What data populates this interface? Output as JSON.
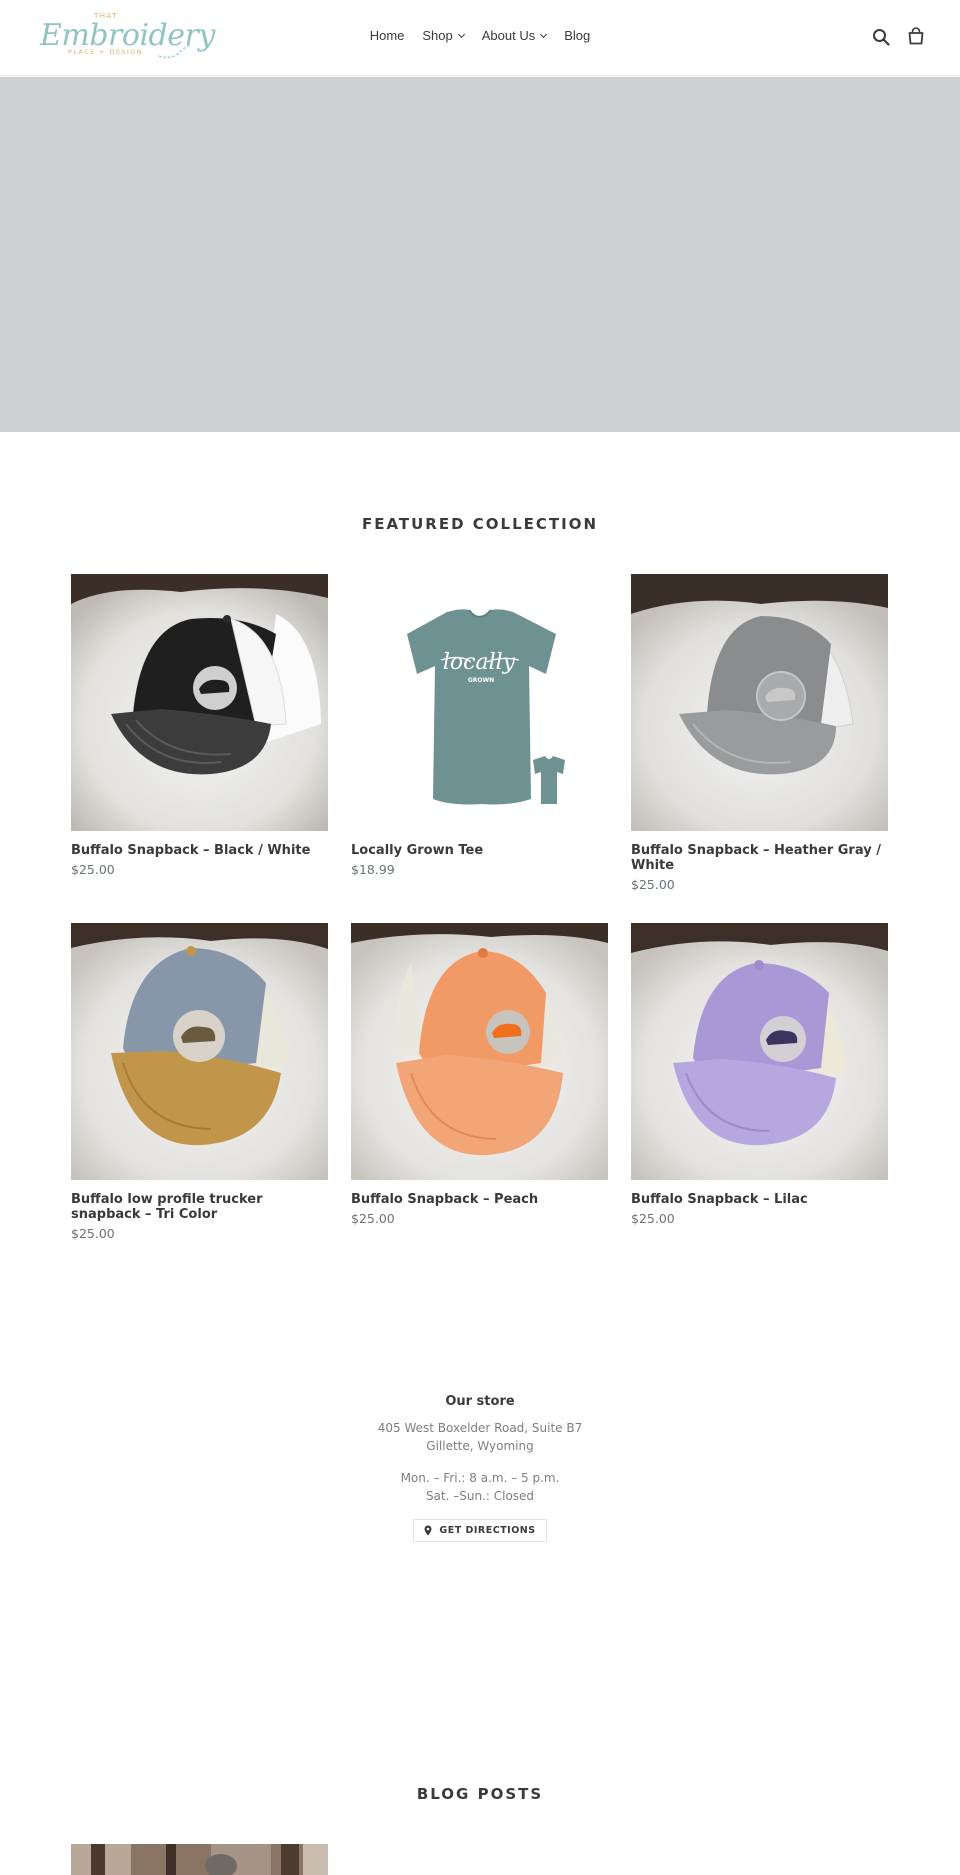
{
  "header": {
    "logo": {
      "small_top": "THAT",
      "script": "Embroidery",
      "small_bottom": "PLACE + DESIGN"
    },
    "nav": [
      {
        "label": "Home",
        "has_dropdown": false
      },
      {
        "label": "Shop",
        "has_dropdown": true
      },
      {
        "label": "About Us",
        "has_dropdown": true
      },
      {
        "label": "Blog",
        "has_dropdown": false
      }
    ],
    "icons": {
      "search": "search-icon",
      "cart": "cart-icon"
    }
  },
  "featured": {
    "title": "FEATURED COLLECTION",
    "products": [
      {
        "name": "Buffalo Snapback – Black / White",
        "price": "$25.00"
      },
      {
        "name": "Locally Grown Tee",
        "price": "$18.99"
      },
      {
        "name": "Buffalo Snapback – Heather Gray / White",
        "price": "$25.00"
      },
      {
        "name": "Buffalo low profile trucker snapback – Tri Color",
        "price": "$25.00"
      },
      {
        "name": "Buffalo Snapback – Peach",
        "price": "$25.00"
      },
      {
        "name": "Buffalo Snapback – Lilac",
        "price": "$25.00"
      }
    ],
    "tee_print": {
      "main": "locally",
      "sub": "GROWN"
    }
  },
  "store": {
    "title": "Our store",
    "address": [
      "405 West Boxelder Road, Suite B7",
      "Gillette, Wyoming"
    ],
    "hours": [
      "Mon. – Fri.: 8 a.m. – 5 p.m.",
      "Sat. –Sun.: Closed"
    ],
    "directions_label": "GET DIRECTIONS"
  },
  "blog": {
    "title": "BLOG POSTS"
  },
  "colors": {
    "hero_bg": "#cfd0d2",
    "logo_teal": "#8fc4c1",
    "logo_gold": "#d9b36b",
    "text": "#3a3a3a",
    "price": "#69727b"
  }
}
